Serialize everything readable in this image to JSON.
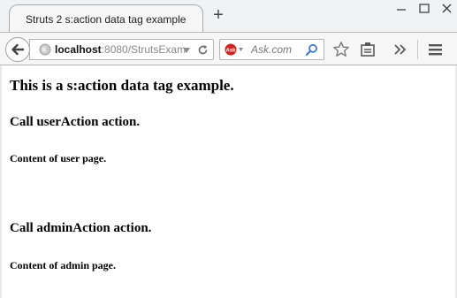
{
  "browser": {
    "tab": {
      "title": "Struts 2 s:action data tag example"
    },
    "new_tab_icon": "plus-icon",
    "url": {
      "host": "localhost",
      "rest": ":8080/StrutsExam"
    },
    "search": {
      "placeholder": "Ask.com",
      "engine_icon": "ask-logo-icon"
    },
    "toolbar_icons": [
      "star-icon",
      "reading-list-icon",
      "overflow-chevron-icon",
      "hamburger-menu-icon"
    ]
  },
  "page": {
    "heading": "This is a s:action data tag example.",
    "section1_title": "Call userAction action.",
    "section1_content": "Content of user page.",
    "section2_title": "Call adminAction action.",
    "section2_content": "Content of admin page."
  },
  "colors": {
    "ask_red": "#d3211f",
    "toolbar_bg": "#f6f6f6",
    "tab_bg": "#f6f6f6"
  }
}
